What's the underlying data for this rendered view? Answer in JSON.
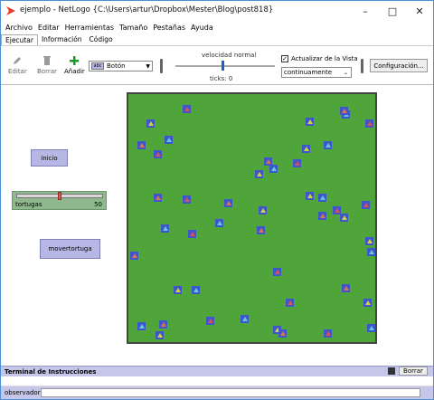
{
  "window": {
    "title": "ejemplo - NetLogo {C:\\Users\\artur\\Dropbox\\Mester\\Blog\\post818}",
    "accent": "#e83a2a"
  },
  "menu": [
    "Archivo",
    "Editar",
    "Herramientas",
    "Tamaño",
    "Pestañas",
    "Ayuda"
  ],
  "tabs": [
    "Ejecutar",
    "Información",
    "Código"
  ],
  "toolbar": {
    "edit_label": "Editar",
    "delete_label": "Borrar",
    "add_label": "Añadir",
    "widget_type": "Botón",
    "speed_label": "velocidad normal",
    "ticks_label": "ticks: 0",
    "update_label": "Actualizar de la Vista",
    "update_checked": true,
    "update_mode": "continuamente",
    "config_label": "Configuración..."
  },
  "interface": {
    "setup_button": "inicio",
    "slider": {
      "label": "tortugas",
      "value": "50",
      "fraction": 0.5
    },
    "move_button": "movertortuga"
  },
  "terminal": {
    "title": "Terminal de Instrucciones",
    "clear_label": "Borrar",
    "prompt": "observador>"
  },
  "colors": {
    "world": "#4fa53a",
    "patch": "#3d57c9",
    "button": "#b7b7e6",
    "slider": "#8fb88f"
  }
}
